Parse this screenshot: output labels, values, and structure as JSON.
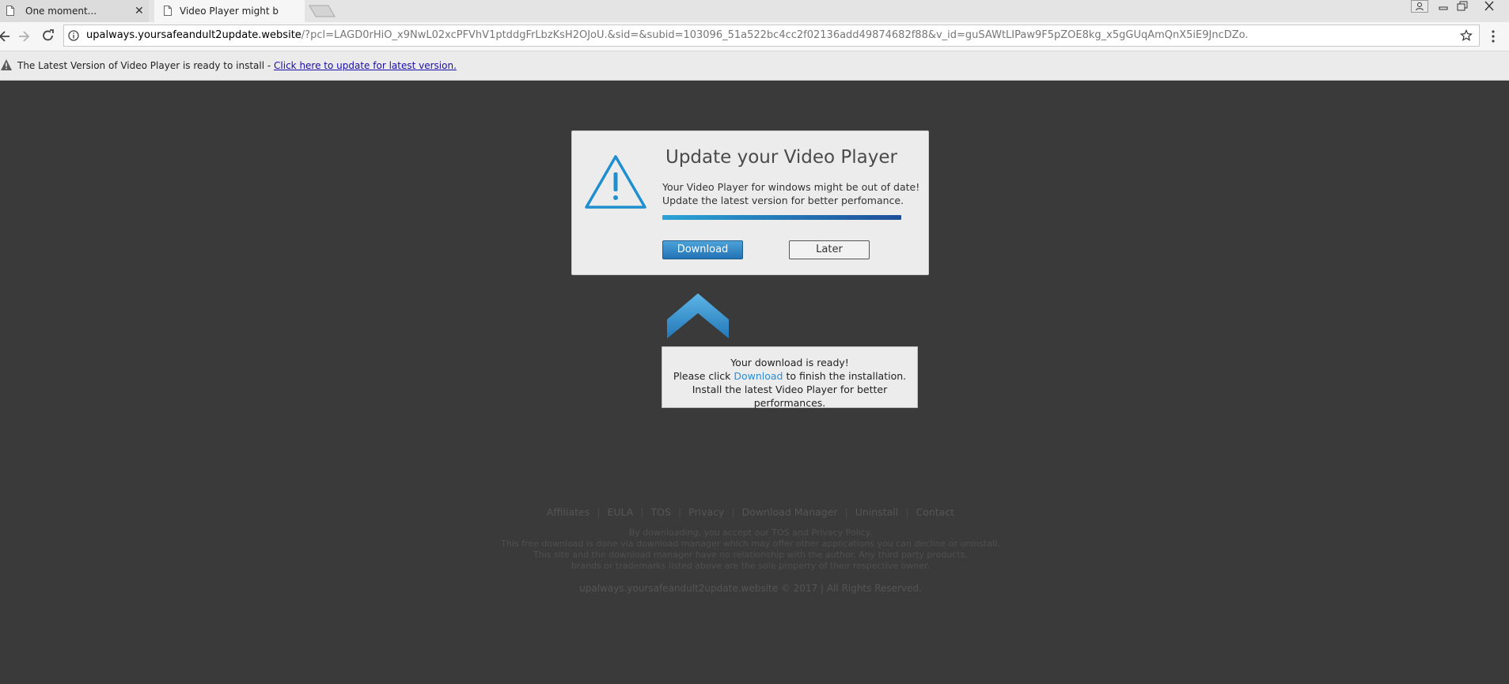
{
  "browser": {
    "tabs": [
      {
        "title": "One moment..."
      },
      {
        "title": "Video Player might be ou"
      }
    ],
    "url_host": "upalways.yoursafeandult2update.website",
    "url_path": "/?pcl=LAGD0rHiO_x9NwL02xcPFVhV1ptddgFrLbzKsH2OJoU.&sid=&subid=103096_51a522bc4cc2f02136add49874682f88&v_id=guSAWtLIPaw9F5pZOE8kg_x5gGUqAmQnX5iE9JncDZo."
  },
  "infobar": {
    "message": "The Latest Version of Video Player is ready to install - ",
    "link": "Click here to update for latest version."
  },
  "dialog": {
    "title": "Update your Video Player",
    "line1": "Your Video Player for windows might be out of date!",
    "line2": "Update the latest version for better perfomance.",
    "progress": 1.0,
    "download_label": "Download",
    "later_label": "Later"
  },
  "tooltip": {
    "line1": "Your download is ready!",
    "line2_pre": "Please click ",
    "line2_link": "Download",
    "line2_post": " to finish the installation.",
    "line3": "Install the latest Video Player for better performances."
  },
  "footer": {
    "links": [
      "Affiliates",
      "EULA",
      "TOS",
      "Privacy",
      "Download Manager",
      "Uninstall",
      "Contact"
    ],
    "disclaimer": [
      "By downloading, you accept our TOS and Privacy Policy.",
      "This free download is done via download manager which may offer other applications you can decline or uninstall.",
      "This site and the download manager have no relationship with the author. Any third party products,",
      "brands or trademarks listed above are the sole property of their respective owner."
    ],
    "copyright": "upalways.yoursafeandult2update.website © 2017 | All Rights Reserved."
  },
  "colors": {
    "page_bg": "#3a3a3a",
    "accent_blue": "#2272b4",
    "icon_blue": "#1f8fcf"
  }
}
